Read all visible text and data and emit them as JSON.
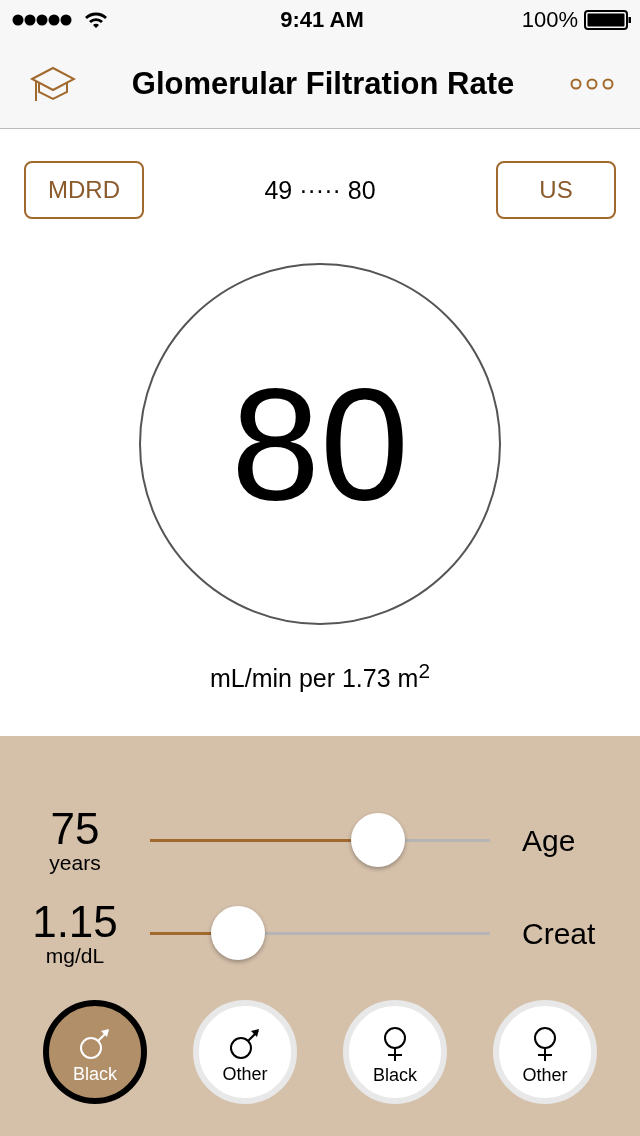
{
  "status_bar": {
    "time": "9:41 AM",
    "battery": "100%"
  },
  "nav": {
    "title": "Glomerular Filtration Rate"
  },
  "formula_button": "MDRD",
  "range": "49 ····· 80",
  "units_button": "US",
  "result": {
    "value": "80",
    "unit": "mL/min per 1.73 m$^{2}$"
  },
  "sliders": [
    {
      "value": "75",
      "unit": "years",
      "label": "Age",
      "level": 0.67
    },
    {
      "value": "1.15",
      "unit": "mg/dL",
      "label": "Creat",
      "level": 0.26
    }
  ],
  "groups": [
    {
      "kind": "male",
      "label": "Black",
      "selected": true
    },
    {
      "kind": "male",
      "label": "Other",
      "selected": false
    },
    {
      "kind": "female",
      "label": "Black",
      "selected": false
    },
    {
      "kind": "female",
      "label": "Other",
      "selected": false
    }
  ]
}
